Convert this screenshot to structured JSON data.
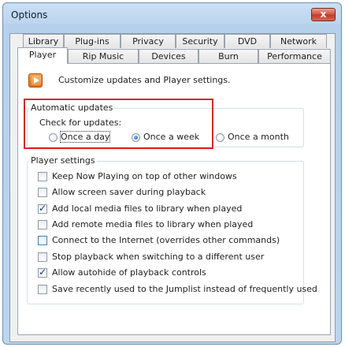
{
  "window": {
    "title": "Options",
    "close_glyph": "x"
  },
  "tabs": {
    "row1": [
      "Library",
      "Plug-ins",
      "Privacy",
      "Security",
      "DVD",
      "Network"
    ],
    "row2": [
      "Player",
      "Rip Music",
      "Devices",
      "Burn",
      "Performance"
    ],
    "active": "Player"
  },
  "intro": {
    "text": "Customize updates and Player settings.",
    "icon": "media-player-icon"
  },
  "automatic_updates": {
    "legend": "Automatic updates",
    "check_label": "Check for updates:",
    "options": [
      "Once a day",
      "Once a week",
      "Once a month"
    ],
    "selected": "Once a week"
  },
  "player_settings": {
    "legend": "Player settings",
    "items": [
      {
        "label": "Keep Now Playing on top of other windows",
        "checked": false
      },
      {
        "label": "Allow screen saver during playback",
        "checked": false
      },
      {
        "label": "Add local media files to library when played",
        "checked": true
      },
      {
        "label": "Add remote media files to library when played",
        "checked": false
      },
      {
        "label": "Connect to the Internet (overrides other commands)",
        "checked": false
      },
      {
        "label": "Stop playback when switching to a different user",
        "checked": false
      },
      {
        "label": "Allow autohide of playback controls",
        "checked": true
      },
      {
        "label": "Save recently used to the Jumplist instead of frequently used",
        "checked": false
      }
    ]
  },
  "colors": {
    "highlight": "#d62828",
    "titlebar": "#bcd5ee",
    "close_button": "#c0392b"
  }
}
